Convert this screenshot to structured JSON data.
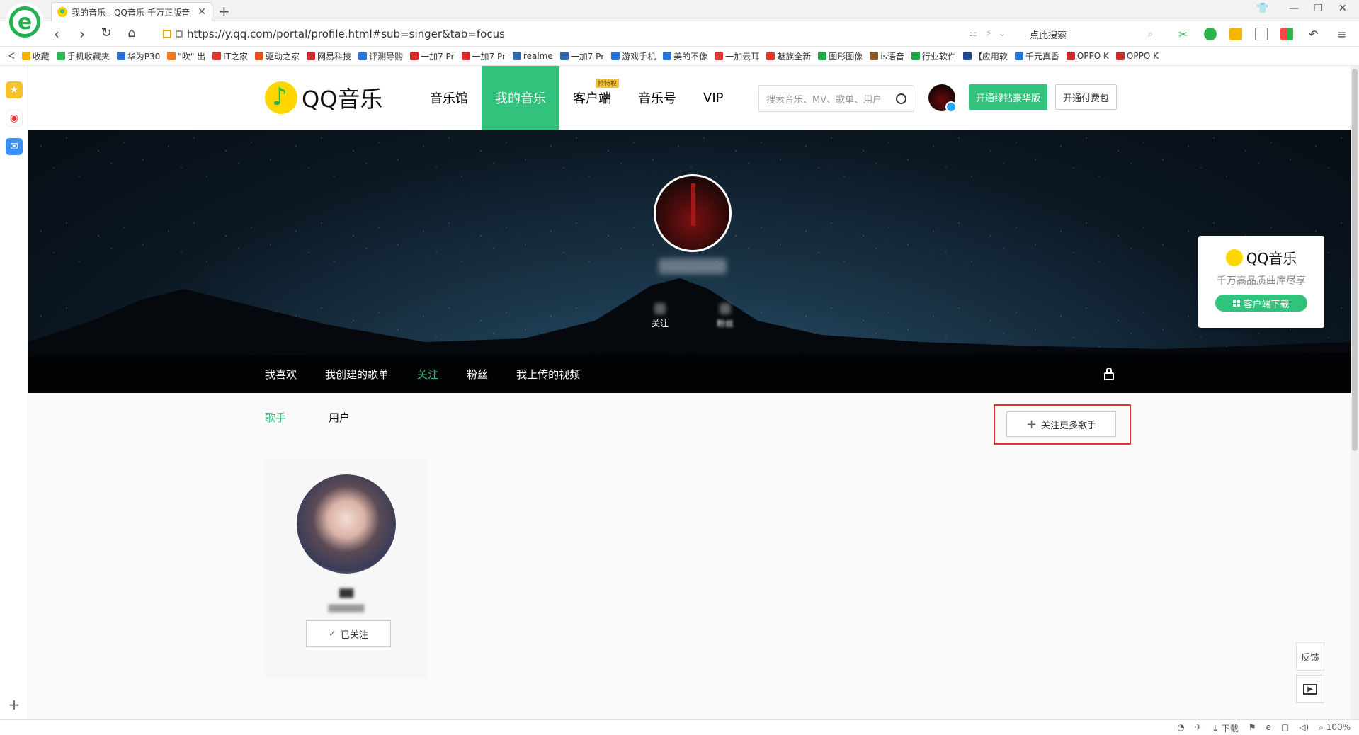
{
  "browser": {
    "tab_title": "我的音乐 - QQ音乐-千万正版音",
    "url": "https://y.qq.com/portal/profile.html#sub=singer&tab=focus",
    "search_placeholder": "点此搜索",
    "new_tab": "+",
    "bookmarks": [
      {
        "label": "收藏",
        "color": "#f5b400"
      },
      {
        "label": "手机收藏夹",
        "color": "#35b558"
      },
      {
        "label": "华为P30",
        "color": "#2d6fd6"
      },
      {
        "label": "\"吹\" 出",
        "color": "#f07a22"
      },
      {
        "label": "IT之家",
        "color": "#d83a2d"
      },
      {
        "label": "驱动之家",
        "color": "#e6531f"
      },
      {
        "label": "网易科技",
        "color": "#c82d2d"
      },
      {
        "label": "评测导购",
        "color": "#2a74d8"
      },
      {
        "label": "一加7 Pr",
        "color": "#d62b2b"
      },
      {
        "label": "一加7 Pr",
        "color": "#d62b2b"
      },
      {
        "label": "realme",
        "color": "#3366aa"
      },
      {
        "label": "一加7 Pr",
        "color": "#3366aa"
      },
      {
        "label": "游戏手机",
        "color": "#2a74d8"
      },
      {
        "label": "美的不像",
        "color": "#2a74d8"
      },
      {
        "label": "一加云耳",
        "color": "#d83a2d"
      },
      {
        "label": "魅族全新",
        "color": "#d83a2d"
      },
      {
        "label": "图形图像",
        "color": "#22a44a"
      },
      {
        "label": "is语音",
        "color": "#8b5a2b"
      },
      {
        "label": "行业软件",
        "color": "#22a44a"
      },
      {
        "label": "【应用软",
        "color": "#234a8a"
      },
      {
        "label": "千元真香",
        "color": "#2a74d8"
      },
      {
        "label": "OPPO K",
        "color": "#c82d2d"
      },
      {
        "label": "OPPO K",
        "color": "#c82d2d"
      }
    ],
    "status": {
      "download": "下载",
      "zoom": "100%"
    }
  },
  "header": {
    "logo_text": "QQ音乐",
    "nav": [
      {
        "label": "音乐馆",
        "active": false
      },
      {
        "label": "我的音乐",
        "active": true
      },
      {
        "label": "客户端",
        "active": false,
        "badge": "抢特权"
      },
      {
        "label": "音乐号",
        "active": false
      },
      {
        "label": "VIP",
        "active": false
      }
    ],
    "search_placeholder": "搜索音乐、MV、歌单、用户",
    "vip_button": "开通绿钻豪华版",
    "pay_button": "开通付费包"
  },
  "profile": {
    "stats": [
      {
        "label": "关注"
      },
      {
        "label": "粉丝"
      }
    ],
    "tabs": [
      "我喜欢",
      "我创建的歌单",
      "关注",
      "粉丝",
      "我上传的视频"
    ],
    "active_tab": "关注"
  },
  "download_card": {
    "brand": "QQ音乐",
    "slogan": "千万高品质曲库尽享",
    "button": "客户端下载"
  },
  "follow": {
    "subtabs": [
      "歌手",
      "用户"
    ],
    "active_subtab": "歌手",
    "follow_more_button": "关注更多歌手",
    "singers": [
      {
        "followed_label": "已关注"
      }
    ]
  },
  "floating": {
    "feedback": "反馈"
  },
  "colors": {
    "brand_green": "#31c27c",
    "highlight_red": "#e53333"
  }
}
